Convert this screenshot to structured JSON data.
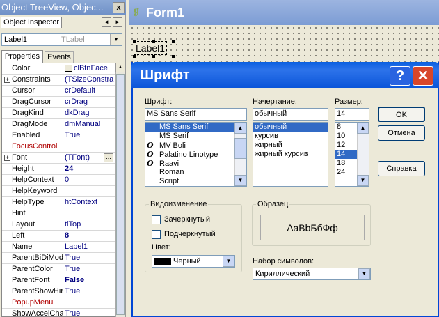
{
  "inspector": {
    "title": "Object TreeView, Objec...",
    "close_label": "x",
    "tab_label": "Object Inspector",
    "nav_left": "◄",
    "nav_right": "►",
    "selected_object": "Label1",
    "selected_type": "TLabel",
    "tabs": [
      "Properties",
      "Events"
    ],
    "rows": [
      {
        "name": "Color",
        "value": "clBtnFace",
        "swatch": "#ece9d8"
      },
      {
        "name": "Constraints",
        "value": "(TSizeConstra",
        "expand": true
      },
      {
        "name": "Cursor",
        "value": "crDefault"
      },
      {
        "name": "DragCursor",
        "value": "crDrag"
      },
      {
        "name": "DragKind",
        "value": "dkDrag"
      },
      {
        "name": "DragMode",
        "value": "dmManual"
      },
      {
        "name": "Enabled",
        "value": "True"
      },
      {
        "name": "FocusControl",
        "value": "",
        "red": true
      },
      {
        "name": "Font",
        "value": "(TFont)",
        "expand": true,
        "ellipsis": "..."
      },
      {
        "name": "Height",
        "value": "24",
        "bold": true
      },
      {
        "name": "HelpContext",
        "value": "0"
      },
      {
        "name": "HelpKeyword",
        "value": ""
      },
      {
        "name": "HelpType",
        "value": "htContext"
      },
      {
        "name": "Hint",
        "value": ""
      },
      {
        "name": "Layout",
        "value": "tlTop"
      },
      {
        "name": "Left",
        "value": "8",
        "bold": true
      },
      {
        "name": "Name",
        "value": "Label1"
      },
      {
        "name": "ParentBiDiMod",
        "value": "True"
      },
      {
        "name": "ParentColor",
        "value": "True"
      },
      {
        "name": "ParentFont",
        "value": "False",
        "bold": true
      },
      {
        "name": "ParentShowHir",
        "value": "True"
      },
      {
        "name": "PopupMenu",
        "value": "",
        "red": true
      },
      {
        "name": "ShowAccelCha",
        "value": "True"
      }
    ]
  },
  "form": {
    "title": "Form1",
    "label": "Label1"
  },
  "dialog": {
    "title": "Шрифт",
    "help": "?",
    "close": "✕",
    "font_label": "Шрифт:",
    "font_value": "MS Sans Serif",
    "fonts": [
      {
        "name": "MS Sans Serif",
        "selected": true,
        "icon": ""
      },
      {
        "name": "MS Serif",
        "icon": ""
      },
      {
        "name": "MV Boli",
        "icon": "O"
      },
      {
        "name": "Palatino Linotype",
        "icon": "O"
      },
      {
        "name": "Raavi",
        "icon": "O"
      },
      {
        "name": "Roman",
        "icon": ""
      },
      {
        "name": "Script",
        "icon": ""
      }
    ],
    "style_label": "Начертание:",
    "style_value": "обычный",
    "styles": [
      {
        "name": "обычный",
        "selected": true
      },
      {
        "name": "курсив"
      },
      {
        "name": "жирный"
      },
      {
        "name": "жирный курсив"
      }
    ],
    "size_label": "Размер:",
    "size_value": "14",
    "sizes": [
      {
        "name": "8"
      },
      {
        "name": "10"
      },
      {
        "name": "12"
      },
      {
        "name": "14",
        "selected": true
      },
      {
        "name": "18"
      },
      {
        "name": "24"
      }
    ],
    "ok": "OK",
    "cancel": "Отмена",
    "help_button": "Справка",
    "effects_label": "Видоизменение",
    "strike_label": "Зачеркнутый",
    "underline_label": "Подчеркнутый",
    "color_label": "Цвет:",
    "color_value": "Черный",
    "color_swatch": "#000000",
    "sample_label": "Образец",
    "sample_text": "AaBbБбФф",
    "script_label": "Набор символов:",
    "script_value": "Кириллический"
  }
}
